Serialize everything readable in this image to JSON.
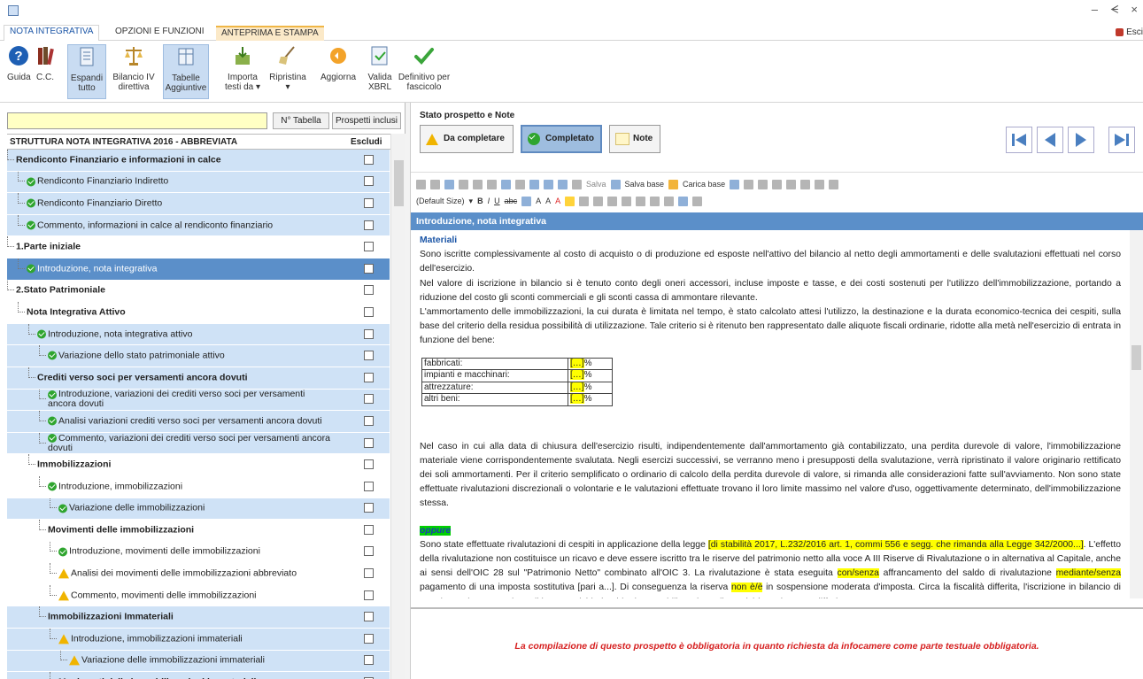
{
  "window": {
    "minimize": "–",
    "restore": "ᗕ",
    "close": "×"
  },
  "ribbon": {
    "tabs": [
      "NOTA INTEGRATIVA",
      "OPZIONI E FUNZIONI",
      "ANTEPRIMA E STAMPA"
    ],
    "exit_label": "Esci",
    "buttons": [
      {
        "label": "Guida"
      },
      {
        "label": "C.C."
      },
      {
        "label": "Espandi tutto"
      },
      {
        "label": "Bilancio IV direttiva"
      },
      {
        "label": "Tabelle Aggiuntive"
      },
      {
        "label": "Importa testi da ▾"
      },
      {
        "label": "Ripristina ▾"
      },
      {
        "label": "Aggiorna"
      },
      {
        "label": "Valida XBRL"
      },
      {
        "label": "Definitivo per fascicolo"
      }
    ]
  },
  "left": {
    "search_value": "",
    "btn_tabella": "N° Tabella",
    "btn_prospetti": "Prospetti inclusi",
    "tree_title": "STRUTTURA NOTA INTEGRATIVA 2016 - ABBREVIATA",
    "col_escludi": "Escludi",
    "rows": [
      {
        "label": "Rendiconto Finanziario e informazioni in calce",
        "level": 0,
        "bold": true,
        "icon": "",
        "style": "blue"
      },
      {
        "label": "Rendiconto Finanziario Indiretto",
        "level": 1,
        "bold": false,
        "icon": "ok",
        "style": "blue"
      },
      {
        "label": "Rendiconto Finanziario Diretto",
        "level": 1,
        "bold": false,
        "icon": "ok",
        "style": "blue"
      },
      {
        "label": "Commento, informazioni in calce al rendiconto finanziario",
        "level": 1,
        "bold": false,
        "icon": "ok",
        "style": "blue"
      },
      {
        "label": "1.Parte iniziale",
        "level": 0,
        "bold": true,
        "icon": "",
        "style": "white"
      },
      {
        "label": "Introduzione, nota integrativa",
        "level": 1,
        "bold": false,
        "icon": "ok",
        "style": "sel"
      },
      {
        "label": "2.Stato Patrimoniale",
        "level": 0,
        "bold": true,
        "icon": "",
        "style": "white"
      },
      {
        "label": "Nota Integrativa Attivo",
        "level": 1,
        "bold": true,
        "icon": "",
        "style": "white"
      },
      {
        "label": "Introduzione, nota integrativa attivo",
        "level": 2,
        "bold": false,
        "icon": "ok",
        "style": "blue"
      },
      {
        "label": "Variazione dello stato patrimoniale attivo",
        "level": 3,
        "bold": false,
        "icon": "ok",
        "style": "blue"
      },
      {
        "label": "Crediti verso soci per versamenti ancora dovuti",
        "level": 2,
        "bold": true,
        "icon": "",
        "style": "blue"
      },
      {
        "label": "Introduzione, variazioni dei crediti verso soci per versamenti ancora dovuti",
        "level": 3,
        "bold": false,
        "icon": "ok",
        "style": "blue",
        "two": true
      },
      {
        "label": "Analisi variazioni crediti verso soci per versamenti ancora dovuti",
        "level": 3,
        "bold": false,
        "icon": "ok",
        "style": "blue"
      },
      {
        "label": "Commento, variazioni dei crediti verso soci per versamenti ancora dovuti",
        "level": 3,
        "bold": false,
        "icon": "ok",
        "style": "blue",
        "two": true
      },
      {
        "label": "Immobilizzazioni",
        "level": 2,
        "bold": true,
        "icon": "",
        "style": "white"
      },
      {
        "label": "Introduzione, immobilizzazioni",
        "level": 3,
        "bold": false,
        "icon": "ok",
        "style": "white"
      },
      {
        "label": "Variazione delle immobilizzazioni",
        "level": 4,
        "bold": false,
        "icon": "ok",
        "style": "blue"
      },
      {
        "label": "Movimenti delle immobilizzazioni",
        "level": 3,
        "bold": true,
        "icon": "",
        "style": "white"
      },
      {
        "label": "Introduzione, movimenti delle immobilizzazioni",
        "level": 4,
        "bold": false,
        "icon": "ok",
        "style": "white"
      },
      {
        "label": "Analisi dei movimenti delle immobilizzazioni abbreviato",
        "level": 4,
        "bold": false,
        "icon": "warn",
        "style": "white"
      },
      {
        "label": "Commento, movimenti delle immobilizzazioni",
        "level": 4,
        "bold": false,
        "icon": "warn",
        "style": "white"
      },
      {
        "label": "Immobilizzazioni Immateriali",
        "level": 3,
        "bold": true,
        "icon": "",
        "style": "blue"
      },
      {
        "label": "Introduzione, immobilizzazioni immateriali",
        "level": 4,
        "bold": false,
        "icon": "warn",
        "style": "blue"
      },
      {
        "label": "Variazione delle immobilizzazioni immateriali",
        "level": 5,
        "bold": false,
        "icon": "warn",
        "style": "blue"
      },
      {
        "label": "Movimenti delle immobilizzazioni immateriali",
        "level": 4,
        "bold": true,
        "icon": "",
        "style": "blue"
      }
    ]
  },
  "right": {
    "stato_title": "Stato prospetto e Note",
    "btn_da_completare": "Da completare",
    "btn_completato": "Completato",
    "btn_note": "Note",
    "editor_line1": {
      "salva": "Salva",
      "salva_base": "Salva base",
      "carica_base": "Carica base"
    },
    "editor_line2": {
      "size": "(Default Size)"
    },
    "section_title": "Introduzione, nota integrativa",
    "doc": {
      "heading": "Materiali",
      "p1": "Sono iscritte complessivamente al costo di acquisto o di produzione ed esposte nell'attivo del bilancio al netto degli ammortamenti e delle svalutazioni effettuati nel corso dell'esercizio.",
      "p2": "Nel valore di iscrizione in bilancio si è tenuto conto degli oneri accessori, incluse imposte e tasse, e dei costi sostenuti per l'utilizzo dell'immobilizzazione, portando a riduzione del costo gli sconti commerciali e gli sconti cassa di ammontare rilevante.",
      "p3": "L'ammortamento delle immobilizzazioni, la cui durata è limitata nel tempo, è stato calcolato attesi l'utilizzo, la destinazione e la durata economico-tecnica dei cespiti, sulla base del criterio della residua possibilità di utilizzazione. Tale criterio si è ritenuto ben rappresentato dalle aliquote fiscali ordinarie, ridotte alla metà nell'esercizio di entrata in funzione del bene:",
      "table": [
        {
          "k": "fabbricati:",
          "v": "[…]",
          "u": "%"
        },
        {
          "k": "impianti e macchinari:",
          "v": "[…]",
          "u": "%"
        },
        {
          "k": "attrezzature:",
          "v": "[…]",
          "u": "%"
        },
        {
          "k": "altri beni:",
          "v": "[…]",
          "u": "%"
        }
      ],
      "p4": "Nel caso in cui alla data di chiusura dell'esercizio risulti, indipendentemente dall'ammortamento già contabilizzato, una perdita durevole di valore, l'immobilizzazione materiale viene corrispondentemente svalutata. Negli esercizi successivi, se verranno meno i presupposti della svalutazione, verrà ripristinato il valore originario rettificato dei soli ammortamenti. Per il criterio semplificato o ordinario di calcolo della perdita durevole di valore, si rimanda alle considerazioni fatte sull'avviamento. Non sono state effettuate rivalutazioni discrezionali o volontarie e le valutazioni effettuate trovano il loro limite massimo nel valore d'uso, oggettivamente determinato, dell'immobilizzazione stessa.",
      "oppure": "oppure",
      "p5a": "Sono state effettuate rivalutazioni di cespiti in applicazione della legge ",
      "p5hl1": "[di stabilità 2017, L.232/2016 art. 1, commi 556 e segg. che rimanda alla Legge 342/2000...]",
      "p5b": ". L'effetto della rivalutazione non costituisce un ricavo e deve essere iscritto tra le riserve del patrimonio netto alla voce A III Riserve di Rivalutazione o in alternativa al Capitale, anche ai sensi dell'OIC 28 sul \"Patrimonio Netto\" combinato all'OIC 3. La rivalutazione è stata eseguita ",
      "p5hl2": "con/senza",
      "p5c": " affrancamento del saldo di rivalutazione ",
      "p5hl3": "mediante/senza",
      "p5d": " pagamento di una imposta sostitutiva [pari a...]. Di conseguenza la riserva ",
      "p5hl4": "non è/è",
      "p5e": " in sospensione moderata d'imposta. Circa la fiscalità differita, l'iscrizione in bilancio di una riserva in sospensione di imposta richiederebbe la contabilizzazione di passività per imposte differite\" ove se ne"
    },
    "footer_message": "La compilazione di questo prospetto è obbligatoria in quanto richiesta da infocamere come parte testuale obbligatoria."
  }
}
